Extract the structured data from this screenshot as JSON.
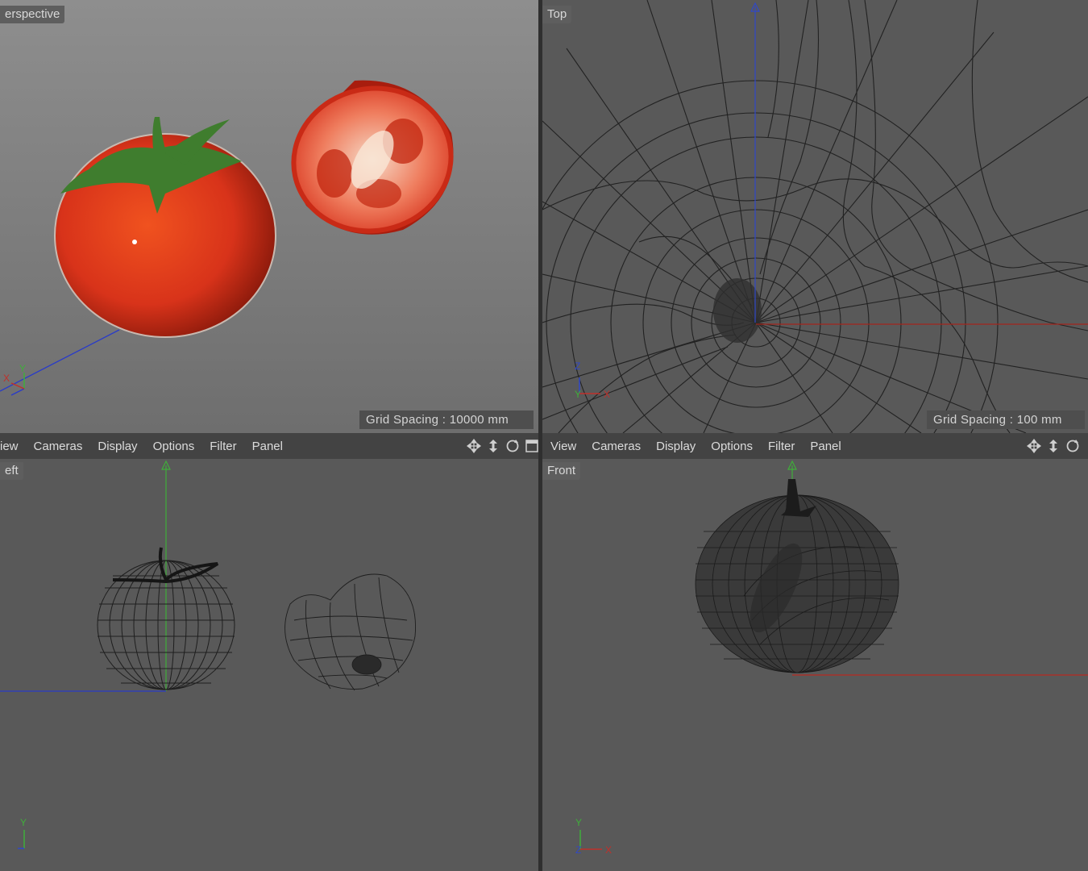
{
  "viewports": {
    "perspective": {
      "label": "erspective",
      "grid_spacing": "Grid Spacing : 10000 mm"
    },
    "top": {
      "label": "Top",
      "grid_spacing": "Grid Spacing : 100 mm"
    },
    "left": {
      "label": "eft"
    },
    "front": {
      "label": "Front"
    }
  },
  "menu_left": {
    "items": [
      "iew",
      "Cameras",
      "Display",
      "Options",
      "Filter",
      "Panel"
    ]
  },
  "menu_right": {
    "items": [
      "View",
      "Cameras",
      "Display",
      "Options",
      "Filter",
      "Panel"
    ]
  },
  "axis_labels": {
    "x": "X",
    "y": "Y",
    "z": "Z"
  },
  "nav_icons": [
    "move-view-icon",
    "dolly-view-icon",
    "rotate-view-icon",
    "maximize-view-icon"
  ],
  "colors": {
    "x_axis": "#c0302a",
    "y_axis": "#3fae3a",
    "z_axis": "#3048c8",
    "tomato": "#d8331a",
    "stem": "#3f7d2e",
    "viewport_bg": "#595959",
    "menubar_bg": "#434343"
  }
}
